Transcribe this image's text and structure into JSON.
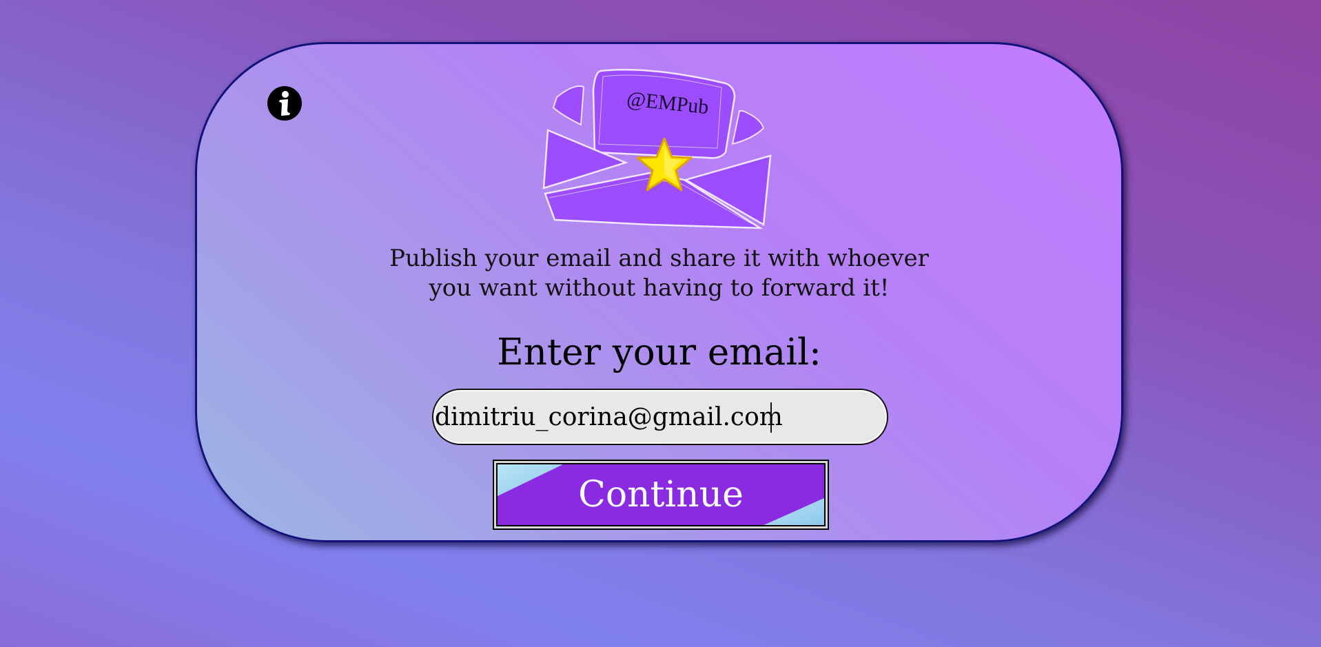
{
  "brand": {
    "logo_text": "@EMPub"
  },
  "icons": {
    "info": "info-icon",
    "logo": "envelope-star-logo",
    "star": "star-icon"
  },
  "tagline": {
    "line1": "Publish your email and share it with whoever",
    "line2": "you want without having to forward it!"
  },
  "form": {
    "heading": "Enter your email:",
    "email_value": "dimitriu_corina@gmail.com",
    "continue_label": "Continue"
  },
  "colors": {
    "background_top": "#8e44a3",
    "background_bottom": "#8080ee",
    "card": "#c27cfd",
    "card_border": "#12127a",
    "envelope": "#9c4dff",
    "star": "#ffe600",
    "button": "#8a2be2",
    "input_bg": "#e8e8e8"
  }
}
